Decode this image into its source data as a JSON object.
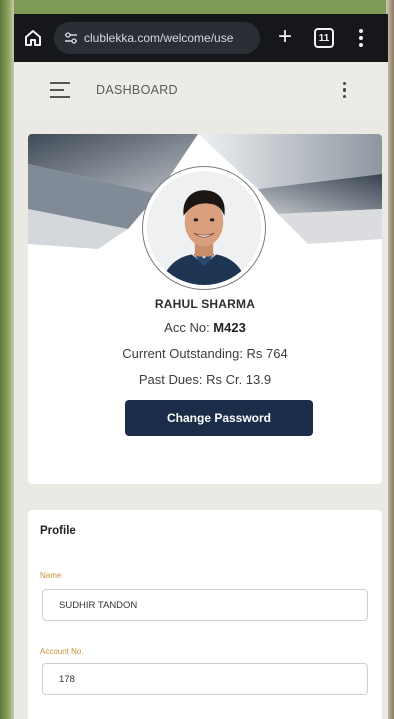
{
  "browser": {
    "url": "clublekka.com/welcome/use",
    "tab_count": "11"
  },
  "app_header": {
    "title": "DASHBOARD"
  },
  "profile_card": {
    "name": "RAHUL SHARMA",
    "acc_label": "Acc No: ",
    "acc_value": "M423",
    "outstanding": "Current Outstanding: Rs 764",
    "past_dues": "Past Dues: Rs Cr. 13.9",
    "change_password_label": "Change Password"
  },
  "profile_form": {
    "title": "Profile",
    "name_label": "Name",
    "name_value": "SUDHIR TANDON",
    "account_no_label": "Account No.",
    "account_no_value": "178"
  },
  "colors": {
    "browser_bar": "#15171b",
    "button": "#1c2d4a",
    "label_accent": "#c9933b"
  },
  "icons": [
    "home-icon",
    "site-settings-icon",
    "plus-icon",
    "tabs-icon",
    "browser-menu-icon",
    "hamburger-menu-icon",
    "kebab-menu-icon"
  ]
}
